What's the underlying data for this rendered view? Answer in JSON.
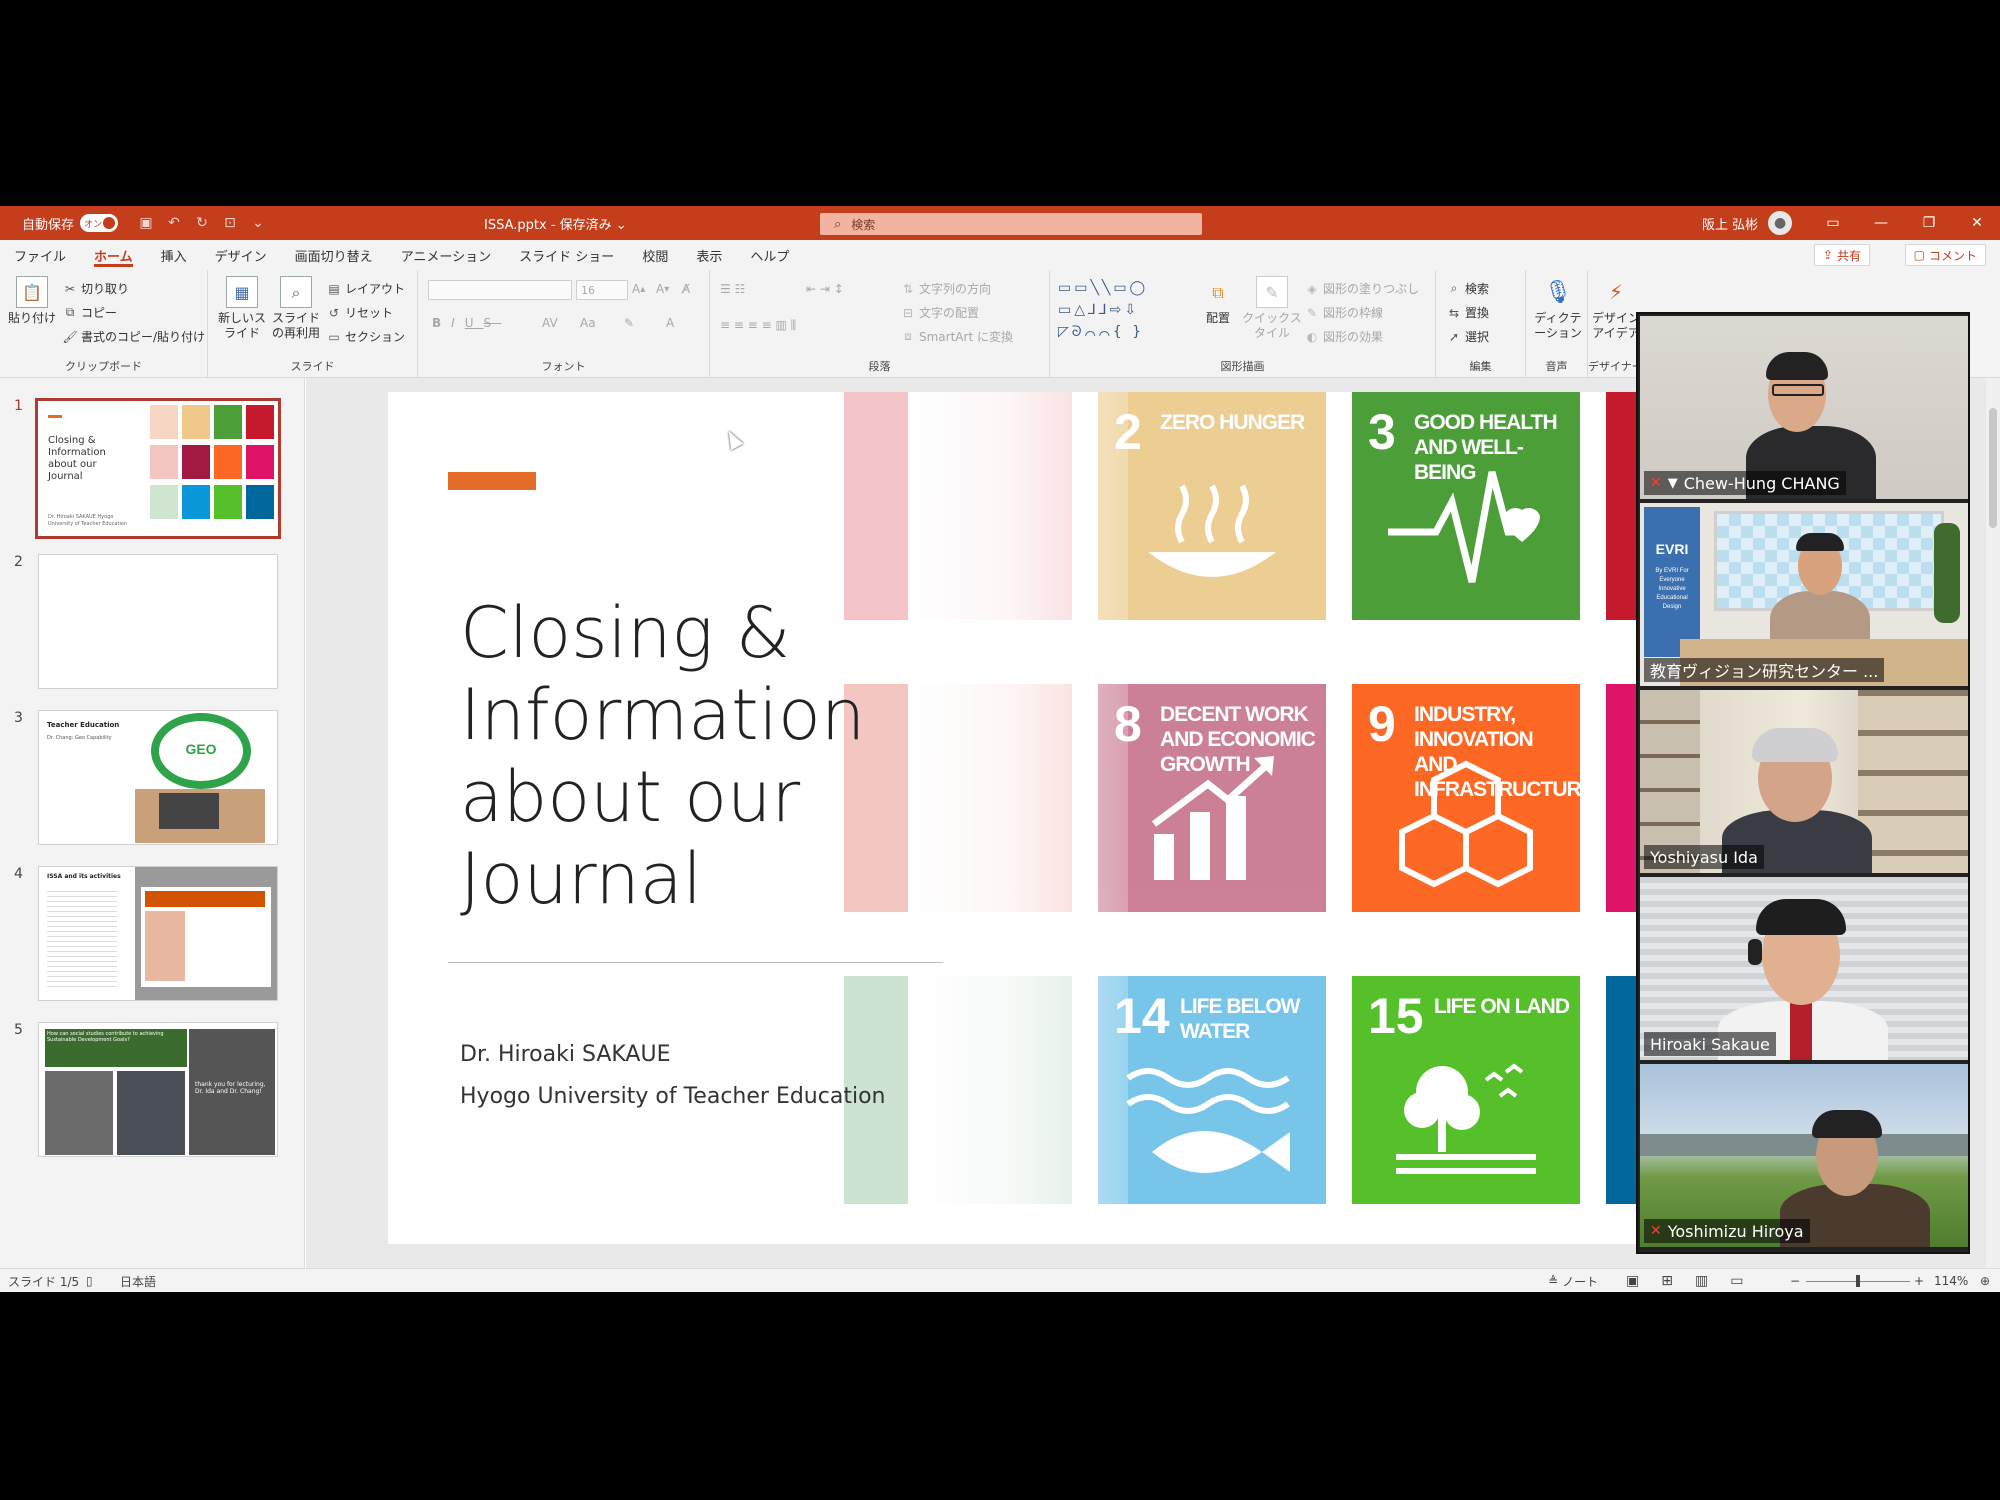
{
  "titlebar": {
    "autosave_label": "自動保存",
    "autosave_state": "オン",
    "doc_title": "ISSA.pptx - 保存済み ⌄",
    "search_placeholder": "検索",
    "user_name": "阪上 弘彬"
  },
  "tabs": [
    "ファイル",
    "ホーム",
    "挿入",
    "デザイン",
    "画面切り替え",
    "アニメーション",
    "スライド ショー",
    "校閲",
    "表示",
    "ヘルプ"
  ],
  "active_tab": "ホーム",
  "share_label": "共有",
  "comment_label": "コメント",
  "ribbon": {
    "clipboard": {
      "paste": "貼り付け",
      "cut": "切り取り",
      "copy": "コピー",
      "format_painter": "書式のコピー/貼り付け",
      "label": "クリップボード"
    },
    "slides": {
      "new_slide": "新しいスライド",
      "reuse": "スライドの再利用",
      "layout": "レイアウト",
      "reset": "リセット",
      "section": "セクション",
      "label": "スライド"
    },
    "font": {
      "size": "16",
      "label": "フォント"
    },
    "paragraph": {
      "text_direction": "文字列の方向",
      "align_text": "文字の配置",
      "smartart": "SmartArt に変換",
      "label": "段落"
    },
    "drawing": {
      "arrange": "配置",
      "quick_styles": "クイックスタイル",
      "shape_fill": "図形の塗りつぶし",
      "shape_outline": "図形の枠線",
      "shape_effects": "図形の効果",
      "label": "図形描画"
    },
    "editing": {
      "find": "検索",
      "replace": "置換",
      "select": "選択",
      "label": "編集"
    },
    "voice": {
      "dictate": "ディクテーション",
      "label": "音声"
    },
    "designer": {
      "ideas": "デザインアイデア",
      "label": "デザイナー"
    }
  },
  "thumbnails": [
    {
      "num": "1",
      "title": "Closing & Information about our Journal",
      "sub": "Dr. Hiroaki SAKAUE Hyogo University of Teacher Education"
    },
    {
      "num": "2",
      "title": "",
      "sub": ""
    },
    {
      "num": "3",
      "title": "Teacher Education",
      "sub": "Dr. Chang: Geo Capability"
    },
    {
      "num": "4",
      "title": "ISSA and its activities",
      "sub": ""
    },
    {
      "num": "5",
      "title": "How can social studies contribute to achieving Sustainable Development Goals?",
      "sub": "thank you for lecturing, Dr. Ida and Dr. Chang!"
    }
  ],
  "slide": {
    "title": "Closing & Information about our Journal",
    "author": "Dr. Hiroaki SAKAUE",
    "affiliation": "Hyogo University of Teacher Education",
    "sdgs": [
      {
        "num": "2",
        "label": "ZERO HUNGER",
        "color": "#DDA63A"
      },
      {
        "num": "3",
        "label": "GOOD HEALTH AND WELL-BEING",
        "color": "#4C9F38"
      },
      {
        "num": "8",
        "label": "DECENT WORK AND ECONOMIC GROWTH",
        "color": "#A21942"
      },
      {
        "num": "9",
        "label": "INDUSTRY, INNOVATION AND INFRASTRUCTURE",
        "color": "#FD6925"
      },
      {
        "num": "14",
        "label": "LIFE BELOW WATER",
        "color": "#0A97D9"
      },
      {
        "num": "15",
        "label": "LIFE ON LAND",
        "color": "#56C02B"
      }
    ]
  },
  "status": {
    "slide_index": "スライド 1/5",
    "language": "日本語",
    "notes": "ノート",
    "zoom": "114%"
  },
  "participants": [
    {
      "name": "Chew-Hung CHANG",
      "muted": true,
      "pinned": true
    },
    {
      "name": "教育ヴィジョン研究センター ...",
      "muted": false,
      "pinned": false
    },
    {
      "name": "Yoshiyasu Ida",
      "muted": false,
      "pinned": false
    },
    {
      "name": "Hiroaki Sakaue",
      "muted": false,
      "pinned": false
    },
    {
      "name": "Yoshimizu Hiroya",
      "muted": true,
      "pinned": false
    }
  ],
  "evri": {
    "logo": "EVRI",
    "tagline": "By EVRI For Everyone Innovative Educational Design"
  }
}
